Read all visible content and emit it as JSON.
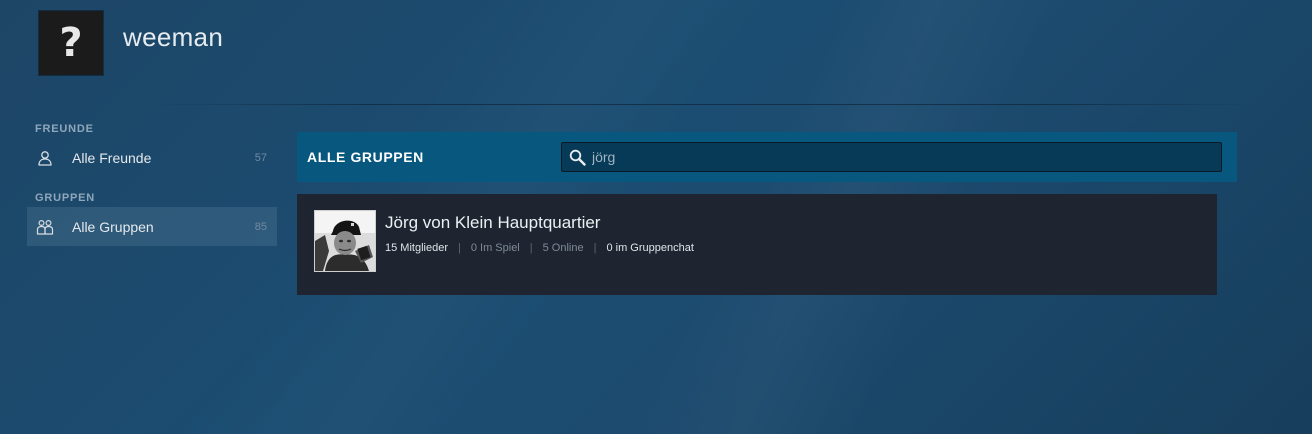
{
  "profile": {
    "avatar_glyph": "?",
    "username": "weeman"
  },
  "sidebar": {
    "friends_section_label": "FREUNDE",
    "groups_section_label": "GRUPPEN",
    "items": [
      {
        "label": "Alle Freunde",
        "count": "57",
        "icon": "person-icon",
        "active": false
      },
      {
        "label": "Alle Gruppen",
        "count": "85",
        "icon": "group-icon",
        "active": true
      }
    ]
  },
  "main": {
    "header_title": "ALLE GRUPPEN",
    "search": {
      "value": "jörg",
      "placeholder": ""
    },
    "groups": [
      {
        "name": "Jörg von Klein Hauptquartier",
        "members": "15 Mitglieder",
        "in_game": "0 Im Spiel",
        "online": "5 Online",
        "in_chat": "0 im Gruppenchat"
      }
    ]
  },
  "colors": {
    "header_bar": "#08577f",
    "card_background": "#1e2530",
    "active_nav": "#4b6b85"
  }
}
